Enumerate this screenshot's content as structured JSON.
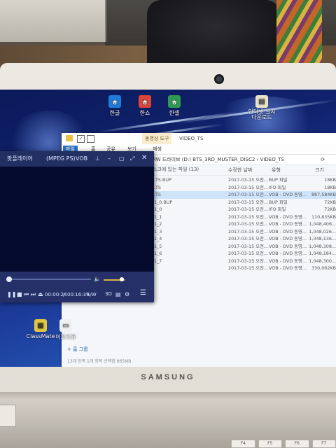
{
  "device": {
    "brand": "SAMSUNG"
  },
  "keyboard": {
    "keys": [
      "F4",
      "F5",
      "F6",
      "F7"
    ]
  },
  "desktop_icons": {
    "hangul": "한글",
    "hanshow": "한쇼",
    "hancell": "한셀",
    "online_install": "인터넷 설치\n다운로드",
    "classmate": "ClassMate",
    "webcam_app": "이프리뷰"
  },
  "explorer": {
    "titlebar": {
      "tools_tab": "동영상 도구",
      "title": "VIDEO_TS"
    },
    "ribbon": {
      "tabs": [
        "파일",
        "홈",
        "공유",
        "보기",
        "재생"
      ]
    },
    "address": "RW 드라이브 (D:) BTS_3RD_MUSTER_DISC2 › VIDEO_TS",
    "columns": {
      "modified": "수정한 날짜",
      "type": "유형",
      "size": "크기"
    },
    "group_label": "스크에 있는 파일 (13)",
    "tree_item": "+ 홈 그룹",
    "status": "13개 항목   1개 항목 선택함 865MB",
    "peek_names": [
      ".TS.BUP",
      ".TS",
      ".TS",
      "1_0.BUP",
      "1_0",
      "1_1",
      "1_2",
      "1_3",
      "1_4",
      "1_5",
      "1_6",
      "1_7"
    ],
    "files": [
      {
        "date": "2017-03-15 오전...",
        "type": "BUP 파일",
        "size": "18KB"
      },
      {
        "date": "2017-03-15 오전...",
        "type": "IFO 파일",
        "size": "18KB"
      },
      {
        "date": "2017-03-15 오전...",
        "type": "VOB - DVD 동영...",
        "size": "887,584KB",
        "selected": true
      },
      {
        "date": "2017-03-15 오전...",
        "type": "BUP 파일",
        "size": "72KB"
      },
      {
        "date": "2017-03-15 오전...",
        "type": "IFO 파일",
        "size": "72KB"
      },
      {
        "date": "2017-03-15 오전...",
        "type": "VOB - DVD 동영...",
        "size": "110,835KB"
      },
      {
        "date": "2017-03-15 오전...",
        "type": "VOB - DVD 동영...",
        "size": "1,048,406..."
      },
      {
        "date": "2017-03-15 오전...",
        "type": "VOB - DVD 동영...",
        "size": "1,048,026..."
      },
      {
        "date": "2017-03-15 오전...",
        "type": "VOB - DVD 동영...",
        "size": "1,048,136..."
      },
      {
        "date": "2017-03-15 오전...",
        "type": "VOB - DVD 동영...",
        "size": "1,048,308..."
      },
      {
        "date": "2017-03-15 오전...",
        "type": "VOB - DVD 동영...",
        "size": "1,048,184..."
      },
      {
        "date": "2017-03-15 오전...",
        "type": "VOB - DVD 동영...",
        "size": "1,048,300..."
      },
      {
        "date": "2017-03-15 오전...",
        "type": "VOB - DVD 동영...",
        "size": "330,062KB"
      }
    ]
  },
  "player": {
    "app_name": "팟플레이어",
    "format": "(MPEG PS)",
    "file": "VOB",
    "time_current": "00:00:24",
    "time_total": "00:16:39",
    "sw_label": "S/W",
    "mode_3d": "3D",
    "seek_progress": 0.024,
    "volume_level": 0.85
  }
}
